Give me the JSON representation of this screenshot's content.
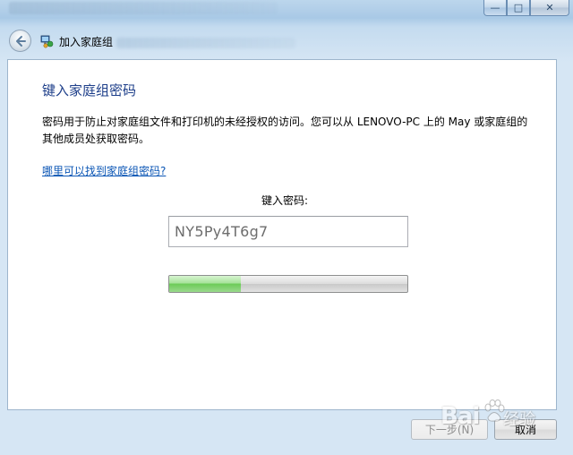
{
  "window": {
    "minimize_glyph": "—",
    "maximize_glyph": "□",
    "close_glyph": "✕"
  },
  "nav": {
    "title": "加入家庭组"
  },
  "content": {
    "heading": "键入家庭组密码",
    "description": "密码用于防止对家庭组文件和打印机的未经授权的访问。您可以从 LENOVO-PC 上的 May 或家庭组的其他成员处获取密码。",
    "help_link": "哪里可以找到家庭组密码?",
    "password_label": "键入密码:",
    "password_value": "NY5Py4T6g7",
    "progress_fraction": 0.3
  },
  "footer": {
    "next_label": "下一步(N)",
    "cancel_label": "取消"
  },
  "watermark": {
    "brand": "Bai",
    "suffix": "经验"
  },
  "colors": {
    "heading": "#1e3f8a",
    "link": "#0b56b5",
    "progress_green": "#6ccb58"
  }
}
